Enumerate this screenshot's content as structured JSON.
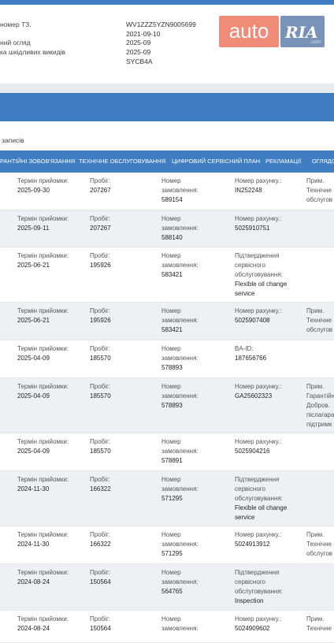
{
  "vehicle": {
    "labels": [
      "номер ТЗ.",
      "ний огляд",
      "ка шкідливих викидів"
    ],
    "values": [
      "WV1ZZZ5YZN9005699",
      "2021-09-10",
      "2025-09",
      "2025-09",
      "SYCB4A"
    ]
  },
  "logo": {
    "auto": "auto",
    "ria": "RIA",
    "com": ".com"
  },
  "search": {
    "records_label": "записів"
  },
  "tabs": [
    "РАНТІЙНІ ЗОБОВ'ЯЗАННЯ",
    "ТЕХНІЧНЕ ОБСЛУГОВУВАННЯ",
    "ЦИФРОВИЙ СЕРВІСНИЙ ПЛАН",
    "РЕКЛАМАЦІЇ",
    "ОГЛЯДО"
  ],
  "colors": {
    "accent": "#3f7ec2",
    "row_alt": "#eef1f4",
    "logo_auto": "#f08b78",
    "logo_ria": "#7893b7"
  },
  "rows": [
    {
      "date_label": "Термін прийомки:",
      "date": "2025-09-30",
      "km_label": "Пробіг:",
      "km": "207267",
      "order_label": [
        "Номер",
        "замовлення:"
      ],
      "order": "589154",
      "c4": [
        "Номер рахунку.:",
        "IN252248"
      ],
      "c5": [
        "Прим.",
        "Технічне",
        "обслугов"
      ]
    },
    {
      "date_label": "Термін прийомки:",
      "date": "2025-09-11",
      "km_label": "Пробіг:",
      "km": "207267",
      "order_label": [
        "Номер",
        "замовлення:"
      ],
      "order": "588140",
      "c4": [
        "Номер рахунку.:",
        "5025910751"
      ],
      "c5": []
    },
    {
      "date_label": "Термін прийомки:",
      "date": "2025-06-21",
      "km_label": "Пробіг:",
      "km": "195926",
      "order_label": [
        "Номер",
        "замовлення:"
      ],
      "order": "583421",
      "c4": [
        "Підтвердження",
        "сервісного",
        "обслуговування:",
        "Flexible oil change",
        "service"
      ],
      "c5": []
    },
    {
      "date_label": "Термін прийомки:",
      "date": "2025-06-21",
      "km_label": "Пробіг:",
      "km": "195926",
      "order_label": [
        "Номер",
        "замовлення:"
      ],
      "order": "583421",
      "c4": [
        "Номер рахунку.:",
        "5025907408"
      ],
      "c5": [
        "Прим.",
        "Технічне",
        "обслугов"
      ]
    },
    {
      "date_label": "Термін прийомки:",
      "date": "2025-04-09",
      "km_label": "Пробіг:",
      "km": "185570",
      "order_label": [
        "Номер",
        "замовлення:"
      ],
      "order": "578893",
      "c4": [
        "BA-ID:",
        "187656766"
      ],
      "c5": []
    },
    {
      "date_label": "Термін прийомки:",
      "date": "2025-04-09",
      "km_label": "Пробіг:",
      "km": "185570",
      "order_label": [
        "Номер",
        "замовлення:"
      ],
      "order": "578893",
      "c4": [
        "Номер рахунку.:",
        "GA25602323"
      ],
      "c5": [
        "Прим.",
        "Гарантійн",
        "Добров.",
        "післагара",
        "підтримк"
      ]
    },
    {
      "date_label": "Термін прийомки:",
      "date": "2025-04-09",
      "km_label": "Пробіг:",
      "km": "185570",
      "order_label": [
        "Номер",
        "замовлення:"
      ],
      "order": "578891",
      "c4": [
        "Номер рахунку.:",
        "5025904216"
      ],
      "c5": []
    },
    {
      "date_label": "Термін прийомки:",
      "date": "2024-11-30",
      "km_label": "Пробіг:",
      "km": "166322",
      "order_label": [
        "Номер",
        "замовлення:"
      ],
      "order": "571295",
      "c4": [
        "Підтвердження",
        "сервісного",
        "обслуговування:",
        "Flexible oil change",
        "service"
      ],
      "c5": []
    },
    {
      "date_label": "Термін прийомки:",
      "date": "2024-11-30",
      "km_label": "Пробіг:",
      "km": "166322",
      "order_label": [
        "Номер",
        "замовлення:"
      ],
      "order": "571295",
      "c4": [
        "Номер рахунку.:",
        "5024913912"
      ],
      "c5": [
        "Прим.",
        "Технічне",
        "обслугов"
      ]
    },
    {
      "date_label": "Термін прийомки:",
      "date": "2024-08-24",
      "km_label": "Пробіг:",
      "km": "150564",
      "order_label": [
        "Номер",
        "замовлення:"
      ],
      "order": "564765",
      "c4": [
        "Підтвердження",
        "сервісного",
        "обслуговування:",
        "Inspection"
      ],
      "c5": []
    },
    {
      "date_label": "Термін прийомки:",
      "date": "2024-08-24",
      "km_label": "Пробіг:",
      "km": "150564",
      "order_label": [
        "Номер",
        "замовлення:"
      ],
      "order": "",
      "c4": [
        "Номер рахунку.:",
        "5024909602"
      ],
      "c5": [
        "Прим.",
        "Технічне"
      ]
    }
  ]
}
